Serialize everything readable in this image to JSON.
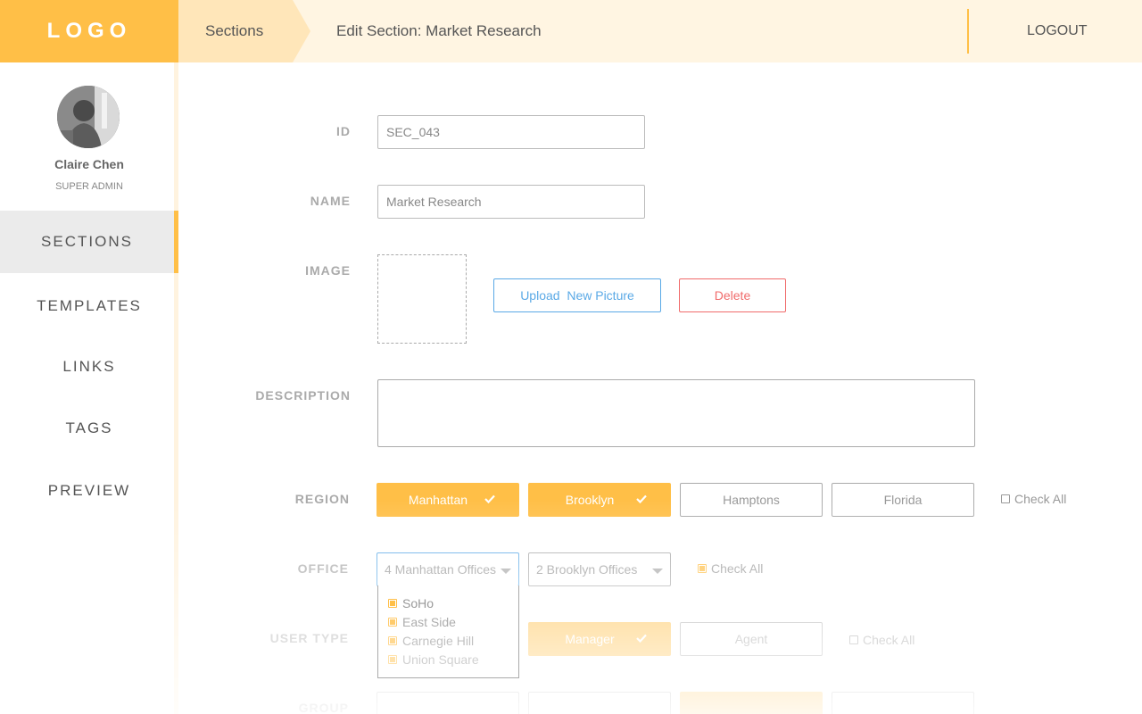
{
  "header": {
    "logo": "LOGO",
    "breadcrumb_root": "Sections",
    "page_title": "Edit Section: Market Research",
    "logout": "LOGOUT"
  },
  "user": {
    "name": "Claire Chen",
    "role": "SUPER ADMIN"
  },
  "nav": {
    "items": [
      {
        "label": "SECTIONS",
        "active": true
      },
      {
        "label": "TEMPLATES",
        "active": false
      },
      {
        "label": "LINKS",
        "active": false
      },
      {
        "label": "TAGS",
        "active": false
      },
      {
        "label": "PREVIEW",
        "active": false
      }
    ]
  },
  "form": {
    "id_label": "ID",
    "id_value": "SEC_043",
    "name_label": "NAME",
    "name_value": "Market Research",
    "image_label": "IMAGE",
    "upload_label": "Upload  New Picture",
    "delete_label": "Delete",
    "description_label": "DESCRIPTION",
    "description_value": "",
    "region_label": "REGION",
    "regions": [
      {
        "label": "Manhattan",
        "selected": true
      },
      {
        "label": "Brooklyn",
        "selected": true
      },
      {
        "label": "Hamptons",
        "selected": false
      },
      {
        "label": "Florida",
        "selected": false
      }
    ],
    "region_check_all": "Check All",
    "office_label": "OFFICE",
    "office_selects": [
      "4 Manhattan Offices",
      "2 Brooklyn Offices"
    ],
    "office_check_all": "Check All",
    "office_dropdown": [
      "SoHo",
      "East Side",
      "Carnegie Hill",
      "Union Square"
    ],
    "user_type_label": "USER TYPE",
    "user_types": [
      {
        "label": "Manager",
        "selected": true
      },
      {
        "label": "Agent",
        "selected": false
      }
    ],
    "user_type_check_all": "Check All",
    "group_label": "GROUP"
  },
  "colors": {
    "accent": "#ffbf47",
    "accent_light": "#ffe6b9",
    "topbar_bg": "#fff5e2",
    "upload": "#5aa9e6",
    "delete": "#f06b6b"
  }
}
